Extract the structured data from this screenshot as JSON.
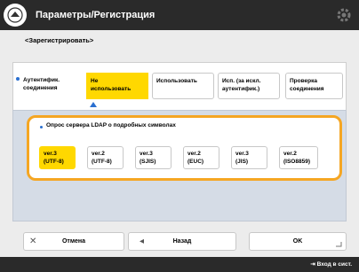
{
  "title": "Параметры/Регистрация",
  "icons": {
    "home": "home-icon",
    "settings": "gear-icon",
    "close": "close-x-icon",
    "back": "arrow-left-icon",
    "ok_corner": "corner-arrow-icon",
    "status": "login-icon"
  },
  "subtitle": "<Зарегистрировать>",
  "tabs": [
    {
      "label": "Аутентифик.\nсоединения"
    },
    {
      "label": "Не\nиспользовать"
    },
    {
      "label": "Использовать"
    },
    {
      "label": "Исп. (за искл.\nаутентифик.)"
    },
    {
      "label": "Проверка\nсоединения"
    }
  ],
  "group_title": "Опрос сервера LDAP о подробных символах",
  "encodings": [
    {
      "label": "ver.3\n(UTF-8)"
    },
    {
      "label": "ver.2\n(UTF-8)"
    },
    {
      "label": "ver.3\n(SJIS)"
    },
    {
      "label": "ver.2\n(EUC)"
    },
    {
      "label": "ver.3\n(JIS)"
    },
    {
      "label": "ver.2\n(ISO8859)"
    }
  ],
  "buttons": {
    "cancel": "Отмена",
    "back": "Назад",
    "ok": "OK"
  },
  "status": "Вход в сист."
}
